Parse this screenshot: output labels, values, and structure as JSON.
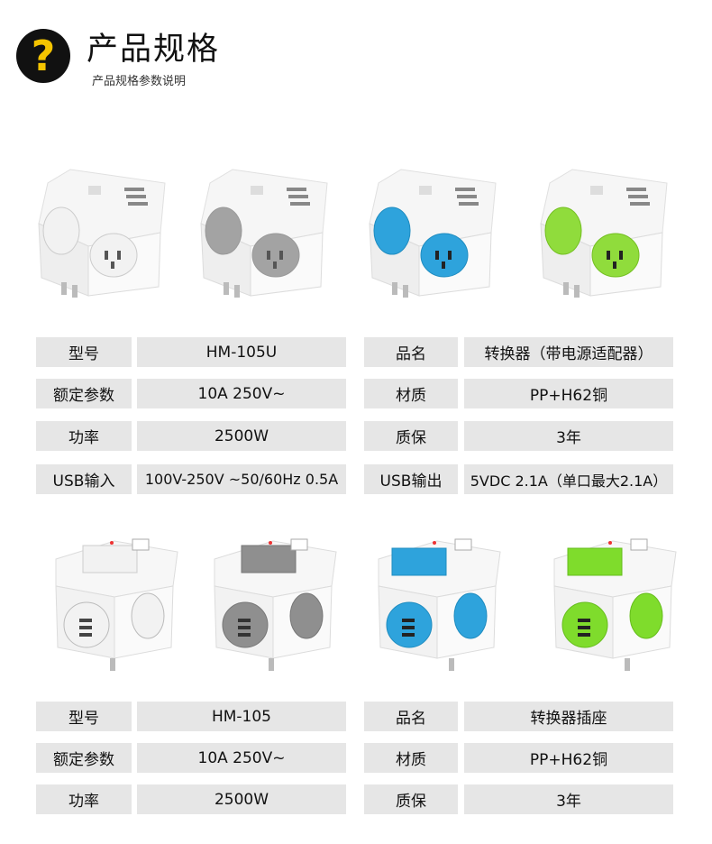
{
  "header": {
    "title": "产品规格",
    "subtitle": "产品规格参数说明",
    "icon": "question-mark-icon"
  },
  "colors": {
    "accent_yellow": "#f5c400",
    "cell_bg": "#e6e6e6",
    "white_variant": "#f4f4f4",
    "grey_variant": "#9e9e9e",
    "blue_variant": "#2aa6e0",
    "green_variant": "#8fdc3a"
  },
  "products_top": [
    {
      "variant": "white",
      "accent": "#f2f2f2"
    },
    {
      "variant": "grey",
      "accent": "#a3a3a3"
    },
    {
      "variant": "blue",
      "accent": "#2ea3dc"
    },
    {
      "variant": "green",
      "accent": "#90dc3c"
    }
  ],
  "products_bottom": [
    {
      "variant": "white",
      "accent": "#f2f2f2"
    },
    {
      "variant": "grey",
      "accent": "#8f8f8f"
    },
    {
      "variant": "blue",
      "accent": "#2ea3dc"
    },
    {
      "variant": "green",
      "accent": "#7fdc2c"
    }
  ],
  "spec_top": {
    "rows": [
      {
        "k1": "型号",
        "v1": "HM-105U",
        "k2": "品名",
        "v2": "转换器（带电源适配器）"
      },
      {
        "k1": "额定参数",
        "v1": "10A   250V~",
        "k2": "材质",
        "v2": "PP+H62铜"
      },
      {
        "k1": "功率",
        "v1": "2500W",
        "k2": "质保",
        "v2": "3年"
      },
      {
        "k1": "USB输入",
        "v1": "100V-250V ~50/60Hz  0.5A",
        "k2": "USB输出",
        "v2": "5VDC  2.1A（单口最大2.1A）"
      }
    ]
  },
  "spec_bottom": {
    "rows": [
      {
        "k1": "型号",
        "v1": "HM-105",
        "k2": "品名",
        "v2": "转换器插座"
      },
      {
        "k1": "额定参数",
        "v1": "10A   250V~",
        "k2": "材质",
        "v2": "PP+H62铜"
      },
      {
        "k1": "功率",
        "v1": "2500W",
        "k2": "质保",
        "v2": "3年"
      }
    ]
  }
}
